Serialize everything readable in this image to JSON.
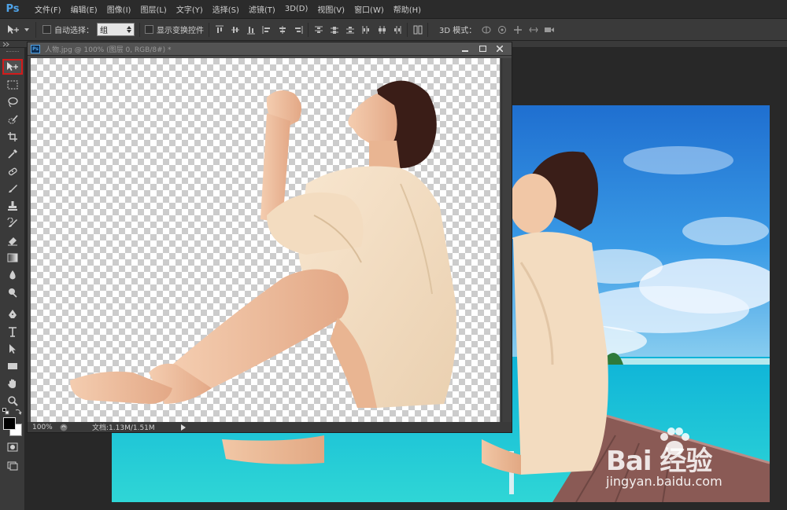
{
  "app": {
    "logo": "Ps"
  },
  "menu": [
    "文件(F)",
    "编辑(E)",
    "图像(I)",
    "图层(L)",
    "文字(Y)",
    "选择(S)",
    "滤镜(T)",
    "3D(D)",
    "视图(V)",
    "窗口(W)",
    "帮助(H)"
  ],
  "options": {
    "auto_select_label": "自动选择：",
    "auto_select_value": "组",
    "show_transform_label": "显示变换控件",
    "mode_3d_label": "3D 模式："
  },
  "document": {
    "title": "人物.jpg @ 100% (图层 0, RGB/8#) *",
    "zoom": "100%",
    "doc_info": "文档:1.13M/1.51M"
  },
  "toolbox": {
    "active_tool": "move-tool",
    "foreground_color": "#000000",
    "background_color": "#ffffff"
  },
  "watermark": {
    "brand": "Bai  经验",
    "url": "jingyan.baidu.com"
  },
  "colors": {
    "highlight": "#d21b1b",
    "ps_blue": "#4fa3e8"
  }
}
